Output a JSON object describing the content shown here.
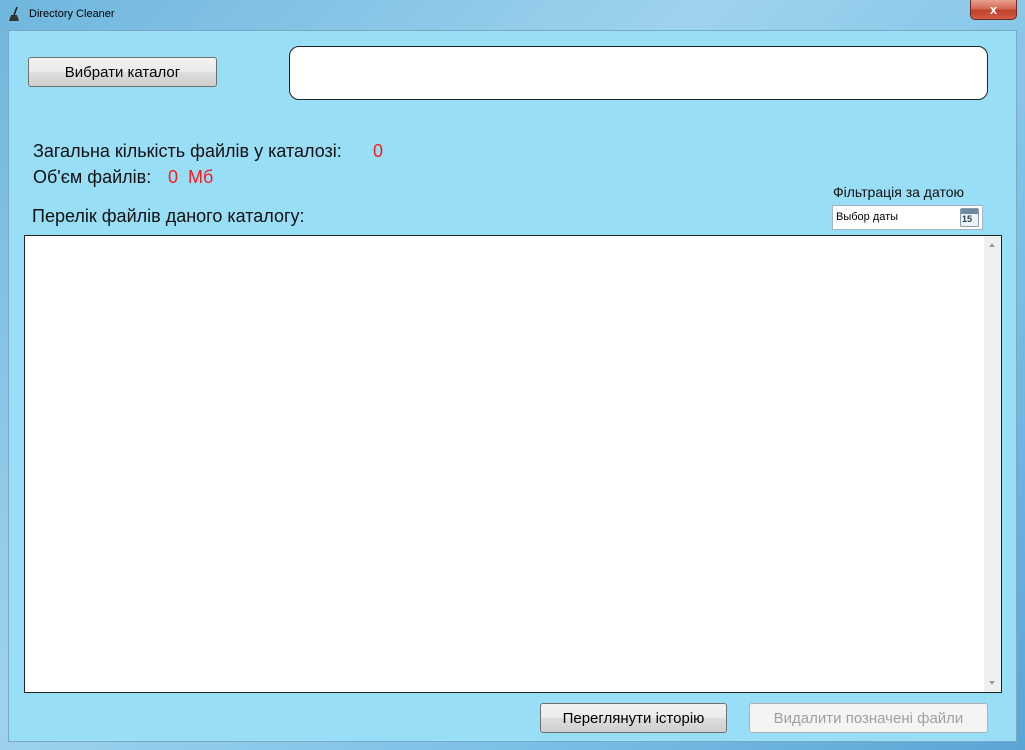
{
  "window": {
    "title": "Directory Cleaner",
    "close_label": "x"
  },
  "toolbar": {
    "choose_dir_label": "Вибрати каталог",
    "path_value": ""
  },
  "stats": {
    "total_files_label": "Загальна кількість файлів у каталозі:",
    "total_files_value": "0",
    "size_label": "Об'єм файлів:",
    "size_value": "0",
    "size_unit": "Мб"
  },
  "list": {
    "title": "Перелік файлів даного каталогу:",
    "items": []
  },
  "filter": {
    "label": "Фільтрація за датою",
    "date_placeholder": "Выбор даты",
    "calendar_icon_day": "15"
  },
  "actions": {
    "history_label": "Переглянути історію",
    "delete_label": "Видалити позначені файли"
  },
  "colors": {
    "client_bg": "#98def6",
    "value_text": "#ff1a1a"
  },
  "icons": {
    "app": "broom-icon",
    "calendar": "calendar-icon",
    "close": "close-icon"
  }
}
